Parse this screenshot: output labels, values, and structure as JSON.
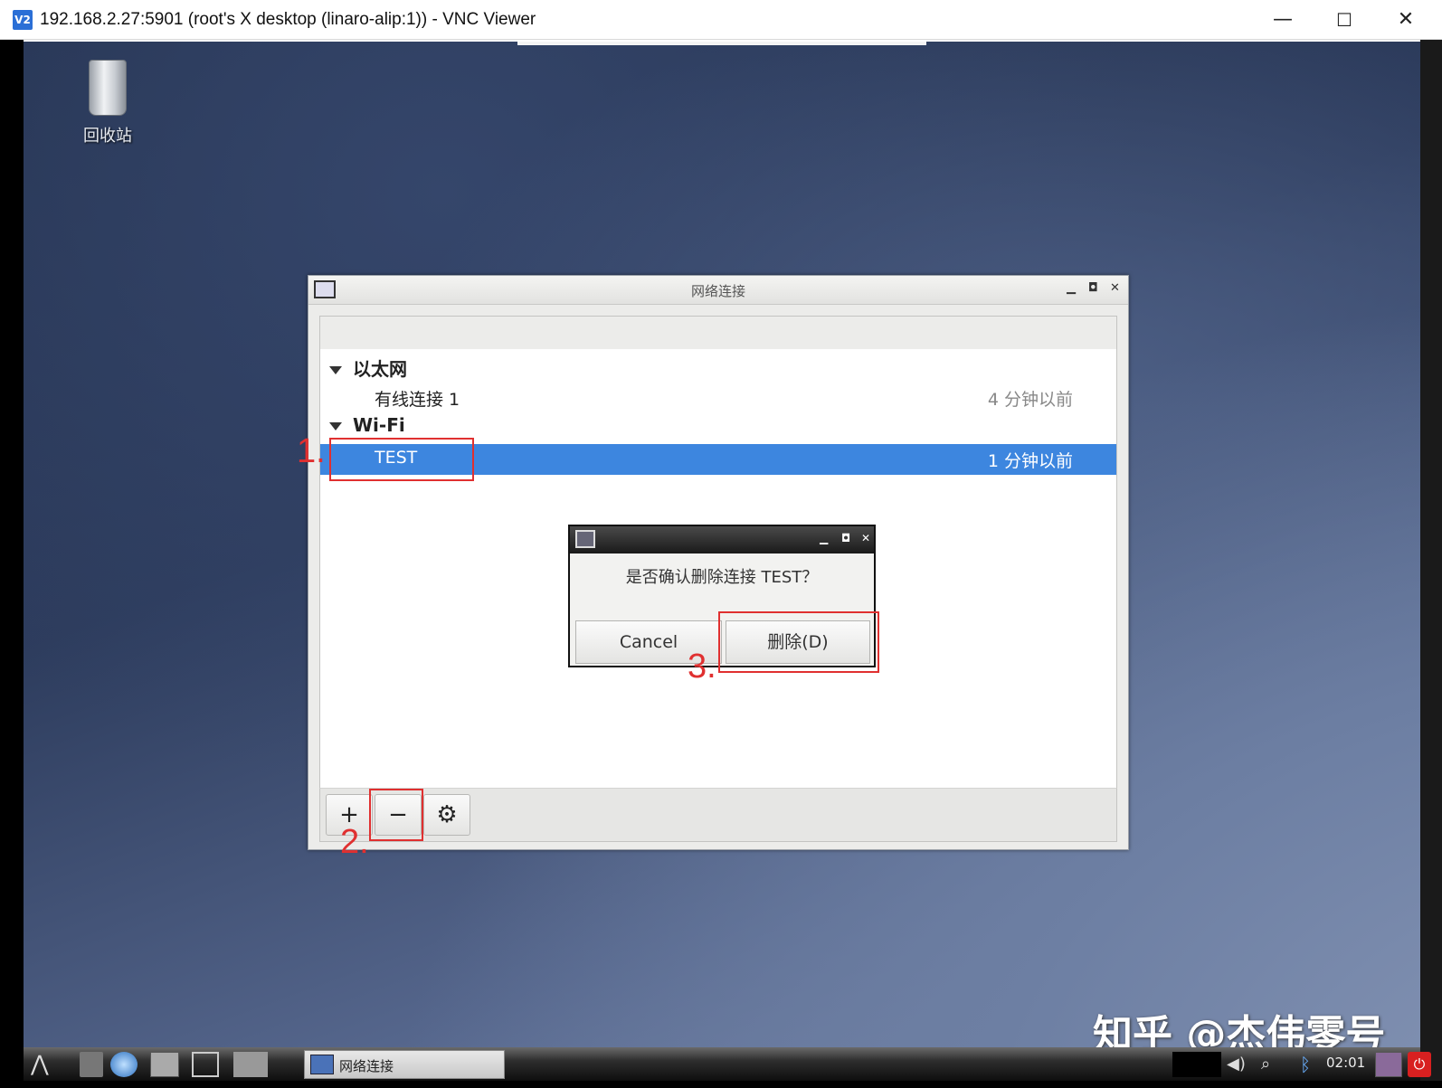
{
  "vnc": {
    "logo": "V2",
    "title": "192.168.2.27:5901 (root's X desktop (linaro-alip:1)) - VNC Viewer",
    "minimize": "—",
    "maximize": "☐",
    "close": "✕"
  },
  "desktop": {
    "trash_label": "回收站",
    "watermark": "知乎 @杰伟零号"
  },
  "nm_window": {
    "title": "网络连接",
    "groups": [
      {
        "label": "以太网",
        "items": [
          {
            "name": "有线连接 1",
            "time": "4 分钟以前"
          }
        ]
      },
      {
        "label": "Wi-Fi",
        "items": [
          {
            "name": "TEST",
            "time": "1 分钟以前",
            "selected": true
          }
        ]
      }
    ],
    "toolbar": {
      "add": "+",
      "remove": "−",
      "settings": "⚙"
    },
    "selected_color": "#3d86df"
  },
  "dialog": {
    "message": "是否确认删除连接 TEST？",
    "cancel_label": "Cancel",
    "delete_label": "删除(D)"
  },
  "annotations": {
    "step1": "1.",
    "step2": "2.",
    "step3": "3.",
    "color": "#e03030"
  },
  "taskbar": {
    "task_label": "网络连接",
    "clock": "02:01"
  }
}
